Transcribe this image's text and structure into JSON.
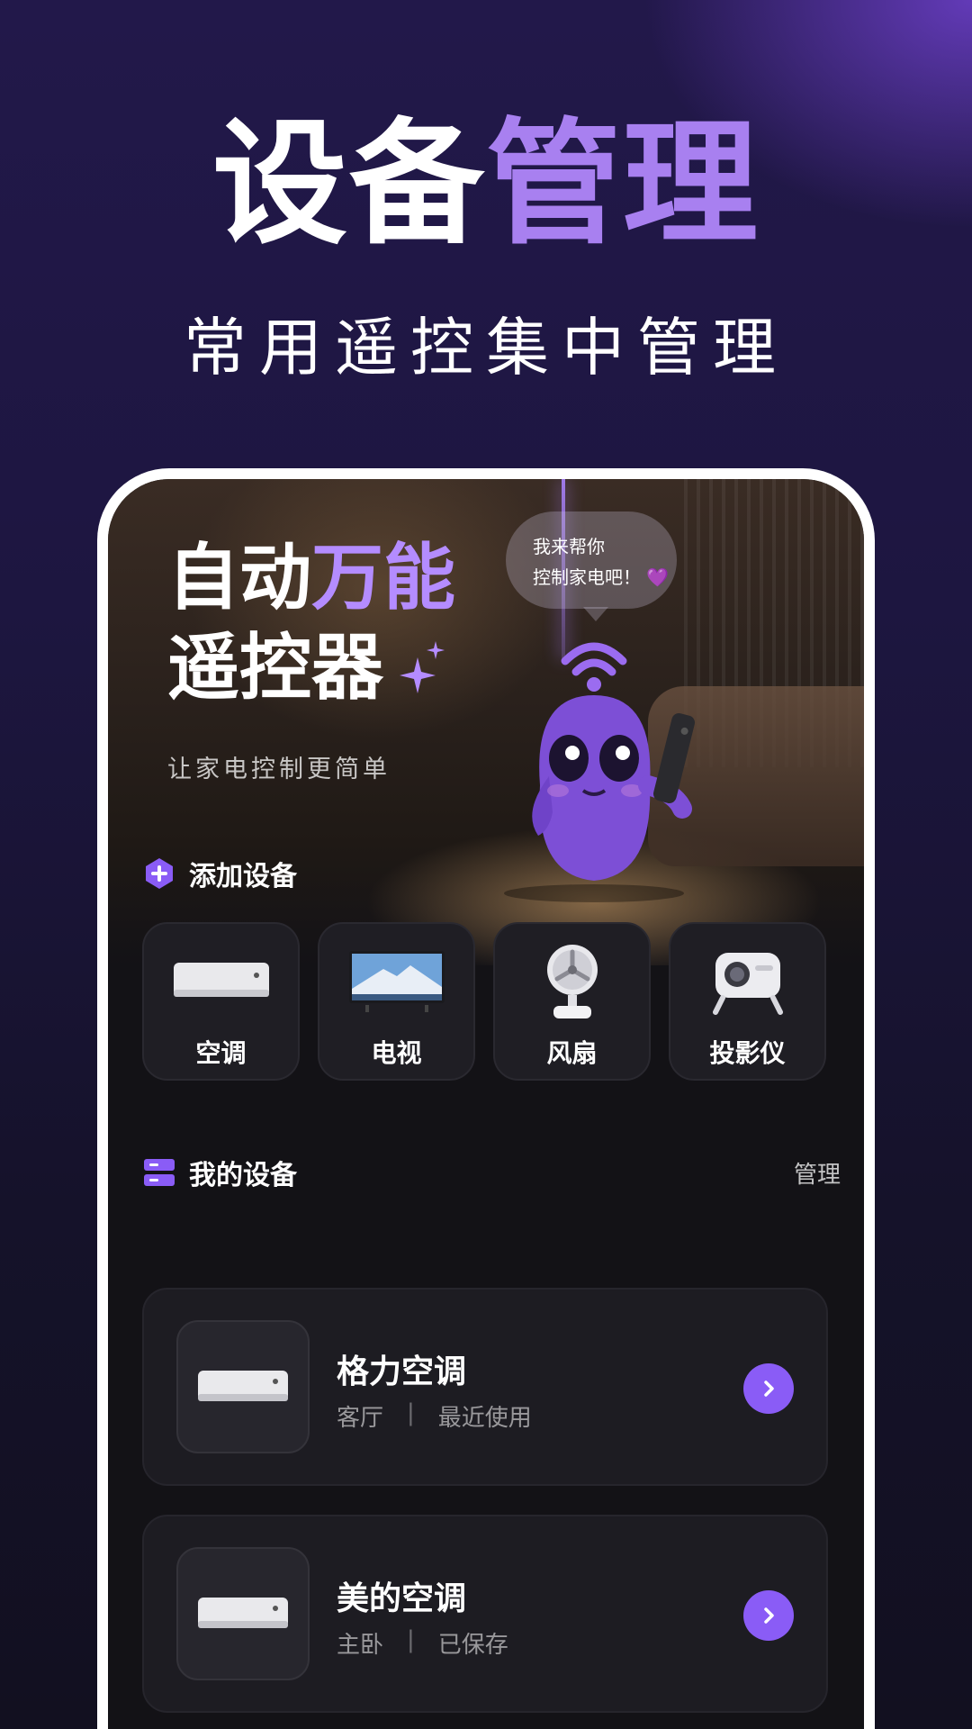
{
  "headline": {
    "white": "设备",
    "purple": "管理"
  },
  "subtitle": "常用遥控集中管理",
  "hero": {
    "title_line1_white": "自动",
    "title_line1_purple": "万能",
    "title_line2": "遥控器",
    "subtitle": "让家电控制更简单",
    "bubble_line1": "我来帮你",
    "bubble_line2": "控制家电吧！",
    "bubble_heart": "💜"
  },
  "add_section": {
    "title": "添加设备",
    "items": [
      {
        "label": "空调",
        "icon": "air-conditioner-icon"
      },
      {
        "label": "电视",
        "icon": "tv-icon"
      },
      {
        "label": "风扇",
        "icon": "fan-icon"
      },
      {
        "label": "投影仪",
        "icon": "projector-icon"
      }
    ]
  },
  "my_devices": {
    "title": "我的设备",
    "manage_label": "管理",
    "devices": [
      {
        "name": "格力空调",
        "room": "客厅",
        "sep": "|",
        "status": "最近使用"
      },
      {
        "name": "美的空调",
        "room": "主卧",
        "sep": "|",
        "status": "已保存"
      }
    ]
  },
  "colors": {
    "accent": "#8a5cf6",
    "headline_purple": "#a880f0",
    "background": "#1a1333"
  }
}
